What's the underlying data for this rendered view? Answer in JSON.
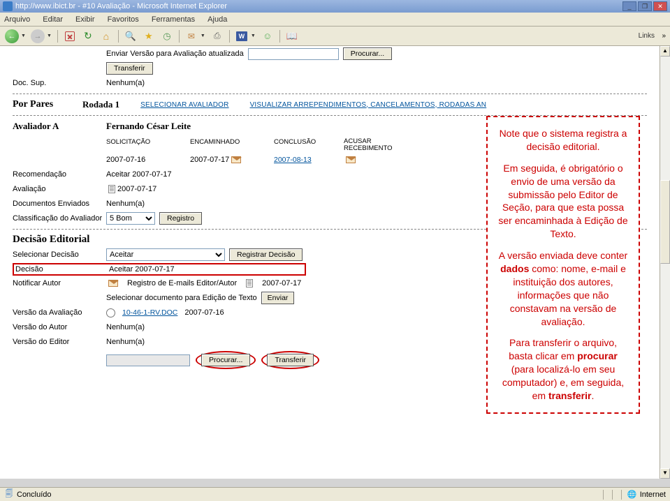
{
  "window": {
    "title": "http://www.ibict.br - #10 Avaliação - Microsoft Internet Explorer",
    "min": "_",
    "max": "❐",
    "close": "✕"
  },
  "menubar": [
    "Arquivo",
    "Editar",
    "Exibir",
    "Favoritos",
    "Ferramentas",
    "Ajuda"
  ],
  "toolbar_links_label": "Links",
  "upload_section": {
    "label": "Enviar Versão para Avaliação atualizada",
    "browse": "Procurar...",
    "transfer": "Transferir",
    "doc_sup_label": "Doc. Sup.",
    "doc_sup_value": "Nenhum(a)"
  },
  "peer": {
    "title": "Por Pares",
    "round": "Rodada 1",
    "select_reviewer": "SELECIONAR AVALIADOR",
    "view_regrets": "VISUALIZAR ARREPENDIMENTOS, CANCELAMENTOS, RODADAS AN"
  },
  "reviewer": {
    "label": "Avaliador A",
    "name": "Fernando César Leite",
    "cols": {
      "solicitacao": "SOLICITAÇÃO",
      "encaminhado": "ENCAMINHADO",
      "conclusao": "CONCLUSÃO",
      "acusar": "ACUSAR RECEBIMENTO"
    },
    "solicitacao_date": "2007-07-16",
    "encaminhado_date": "2007-07-17",
    "conclusao_date": "2007-08-13",
    "recomendacao_label": "Recomendação",
    "recomendacao_value": "Aceitar  2007-07-17",
    "avaliacao_label": "Avaliação",
    "avaliacao_date": "2007-07-17",
    "docs_label": "Documentos Enviados",
    "docs_value": "Nenhum(a)",
    "rating_label": "Classificação do Avaliador",
    "rating_value": "5 Bom",
    "registro_btn": "Registro"
  },
  "decision": {
    "heading": "Decisão Editorial",
    "select_label": "Selecionar Decisão",
    "select_value": "Aceitar",
    "register_btn": "Registrar Decisão",
    "decision_label": "Decisão",
    "decision_value": "Aceitar  2007-07-17",
    "notify_label": "Notificar Autor",
    "email_log_label": "Registro de E-mails Editor/Autor",
    "email_log_date": "2007-07-17",
    "select_doc_label": "Selecionar documento para Edição de Texto",
    "send_btn": "Enviar",
    "review_version_label": "Versão da Avaliação",
    "review_version_file": "10-46-1-RV.DOC",
    "review_version_date": "2007-07-16",
    "author_version_label": "Versão do Autor",
    "author_version_value": "Nenhum(a)",
    "editor_version_label": "Versão do Editor",
    "editor_version_value": "Nenhum(a)",
    "browse_btn": "Procurar...",
    "transfer_btn": "Transferir"
  },
  "annotation": {
    "p1": "Note que o sistema registra a decisão editorial.",
    "p2": "Em seguida, é obrigatório o envio de uma versão da submissão pelo Editor de Seção, para que esta possa ser encaminhada à Edição de Texto.",
    "p3_a": "A versão enviada deve conter ",
    "p3_b": "dados",
    "p3_c": " como: nome, e-mail e instituição dos autores, informações que não constavam na versão de avaliação.",
    "p4_a": "Para transferir o arquivo, basta clicar em ",
    "p4_b": "procurar",
    "p4_c": " (para localizá-lo em seu computador) e, em seguida, em ",
    "p4_d": "transferir",
    "p4_e": "."
  },
  "statusbar": {
    "done": "Concluído",
    "zone": "Internet"
  }
}
